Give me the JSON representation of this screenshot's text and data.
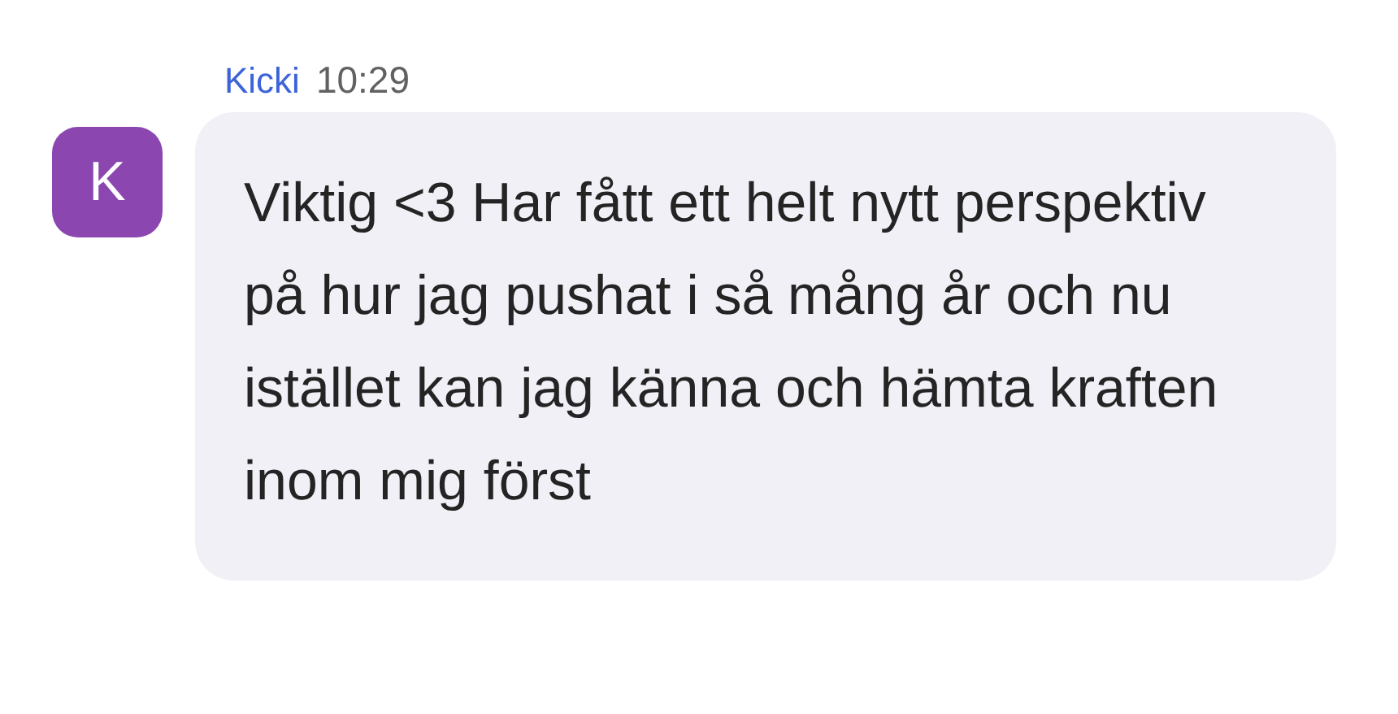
{
  "message": {
    "avatar_initial": "K",
    "sender": "Kicki",
    "time": "10:29",
    "text": "Viktig <3 Har fått ett helt nytt perspektiv på hur jag pushat i så mång år och nu istället kan jag känna och hämta kraften inom mig först"
  }
}
